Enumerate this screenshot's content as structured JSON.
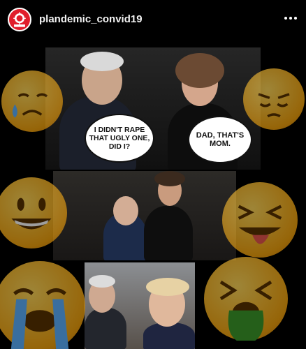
{
  "header": {
    "username": "plandemic_convid19",
    "avatar_icon": "virus-logo-icon",
    "more_icon": "more-options-icon"
  },
  "post": {
    "panel1": {
      "bubble_left": "I DIDN'T RAPE THAT UGLY ONE, DID I?",
      "bubble_right": "DAD, THAT'S MOM."
    },
    "emojis": [
      "crying-face-icon",
      "pensive-face-icon",
      "grinning-face-icon",
      "squinting-tongue-face-icon",
      "loudly-crying-face-icon",
      "vomiting-face-icon"
    ]
  }
}
